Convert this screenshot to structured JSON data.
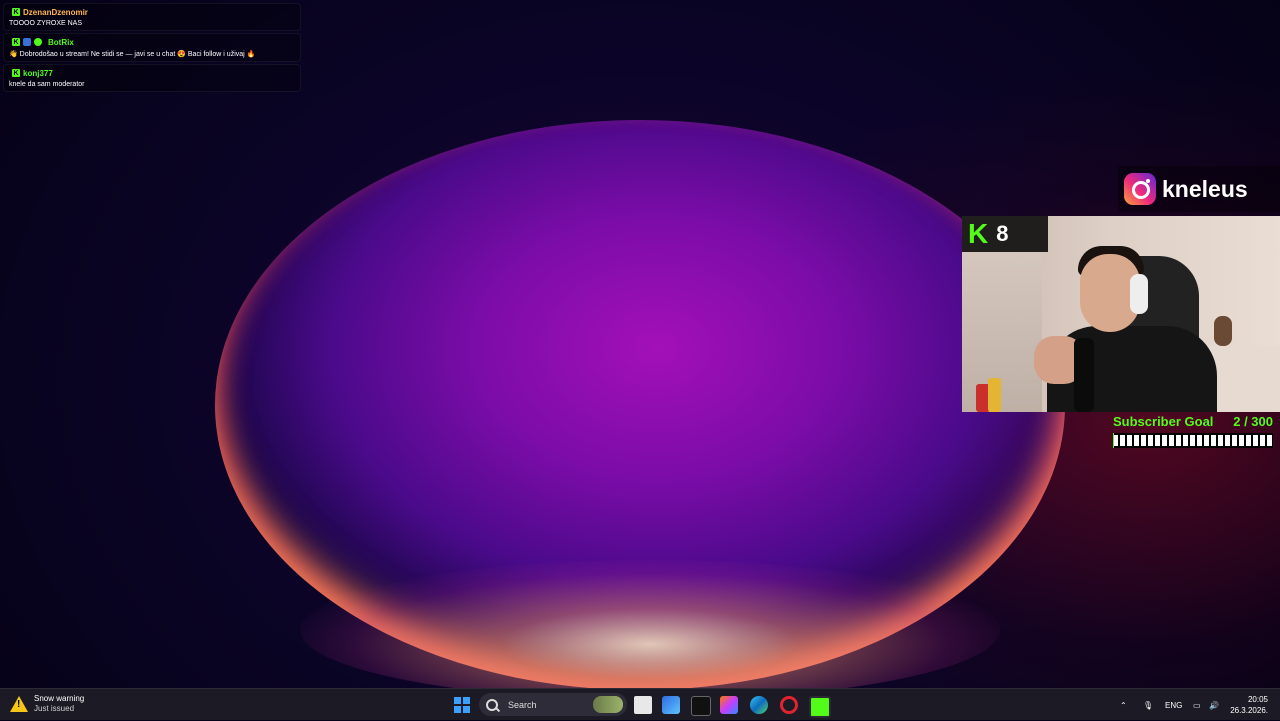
{
  "chat": {
    "messages": [
      {
        "user": "DzenanDzenomir",
        "user_color": "#ffb84d",
        "text": "TOOOO ZYROXE NAS"
      },
      {
        "user": "BotRix",
        "user_color": "#53fc18",
        "text": "👋 Dobrodošao u stream! Ne stidi se — javi se u chat 😍 Baci follow i uživaj 🔥"
      },
      {
        "user": "konj377",
        "user_color": "#53fc18",
        "text": "knele da sam moderator"
      }
    ]
  },
  "overlay": {
    "instagram_handle": "kneleus",
    "kick_viewers": "8",
    "kick_logo": "K",
    "sub_goal_label": "Subscriber Goal",
    "sub_goal_count": "2 / 300",
    "sub_goal_progress": 0.0067,
    "accent_color": "#53fc18"
  },
  "taskbar": {
    "weather_title": "Snow warning",
    "weather_subtitle": "Just issued",
    "search_label": "Search",
    "language": "ENG",
    "time": "20:05",
    "date": "26.3.2026."
  }
}
